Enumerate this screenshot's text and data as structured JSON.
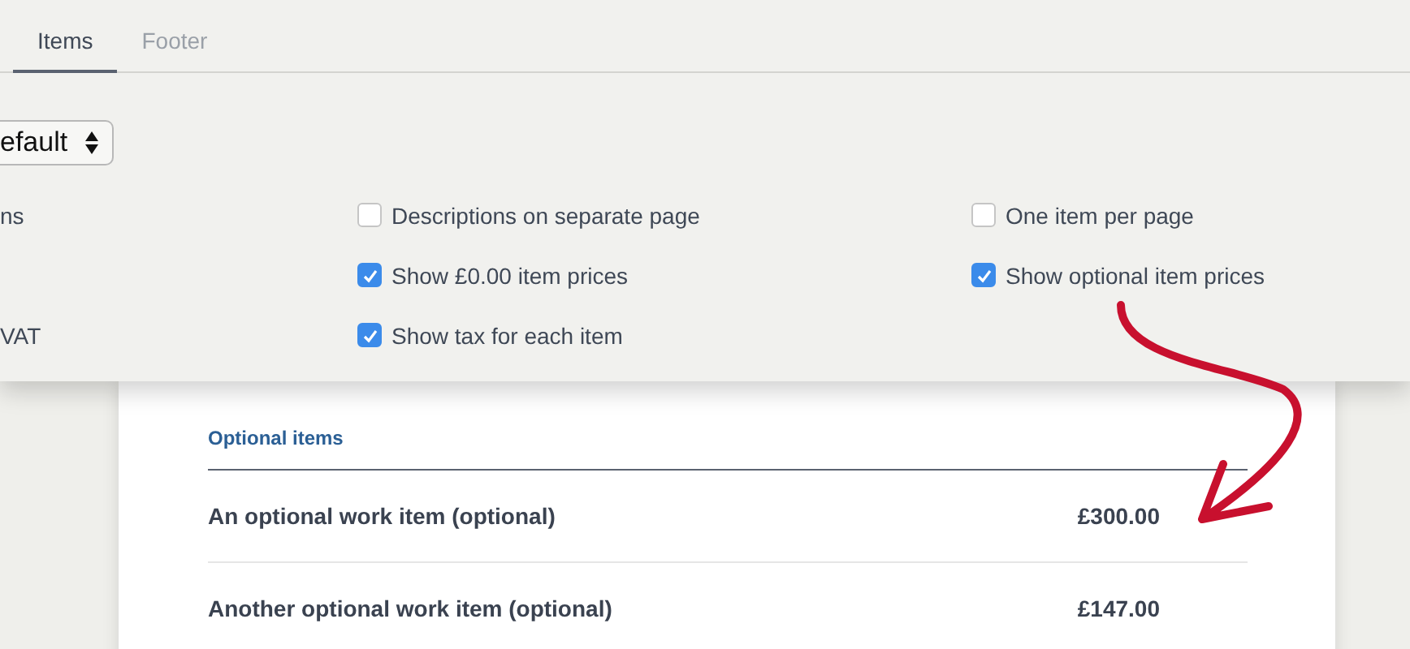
{
  "tabs": [
    {
      "label": "Items",
      "selected": true
    },
    {
      "label": "Footer",
      "selected": false
    }
  ],
  "select": {
    "value": "efault"
  },
  "options": [
    {
      "kind": "label",
      "label": "ns"
    },
    {
      "kind": "checkbox",
      "label": "Descriptions on separate page",
      "checked": false
    },
    {
      "kind": "checkbox",
      "label": "One item per page",
      "checked": false
    },
    {
      "kind": "empty"
    },
    {
      "kind": "checkbox",
      "label": "Show £0.00 item prices",
      "checked": true
    },
    {
      "kind": "checkbox",
      "label": "Show optional item prices",
      "checked": true
    },
    {
      "kind": "label",
      "label": "VAT"
    },
    {
      "kind": "checkbox",
      "label": "Show tax for each item",
      "checked": true
    },
    {
      "kind": "empty"
    }
  ],
  "document": {
    "heading": "Optional items",
    "rows": [
      {
        "name": "An optional work item (optional)",
        "price": "£300.00"
      },
      {
        "name": "Another optional work item (optional)",
        "price": "£147.00"
      }
    ]
  }
}
